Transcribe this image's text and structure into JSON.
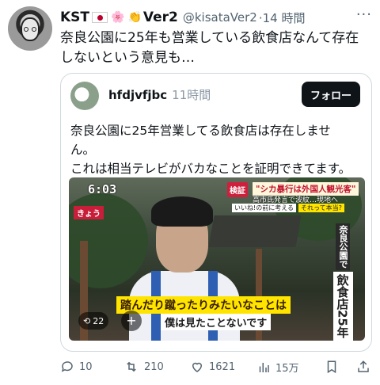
{
  "post": {
    "display_name": "KST",
    "emojis": [
      "🌸",
      "👏"
    ],
    "name_suffix": "Ver2",
    "handle": "@kisataVer2",
    "time": "14 時間",
    "text": "奈良公園に25年も営業している飲食店なんて存在しないという意見も…"
  },
  "quote": {
    "username": "hfdjvfjbc",
    "time": "11時間",
    "follow_label": "フォロー",
    "text_line1": "奈良公園に25年営業してる飲食店は存在しませ",
    "text_line2": "ん。",
    "text_line3": "これは相当テレビがバカなことを証明できてます。",
    "video": {
      "timestamp": "6:03",
      "today_badge": "きょう",
      "news_tag": "検証",
      "news_headline": "\"シカ暴行は外国人観光客\"",
      "news_sub": "高市氏発言で波紋…現地へ",
      "news_q1": "いいね!の前に考える",
      "news_q2": "それって本当?",
      "vert_small": "奈良公園で",
      "vert_big": "飲食店25年",
      "subtitle1": "踏んだり蹴ったりみたいなことは",
      "subtitle2": "僕は見たことないです",
      "repost_count": "22",
      "plus": "+"
    }
  },
  "actions": {
    "replies": "10",
    "reposts": "210",
    "likes": "1621",
    "views": "15万"
  },
  "icons": {
    "more": "more-icon",
    "reply": "reply-icon",
    "repost": "repost-icon",
    "like": "heart-icon",
    "views": "views-icon",
    "bookmark": "bookmark-icon",
    "share": "share-icon"
  }
}
